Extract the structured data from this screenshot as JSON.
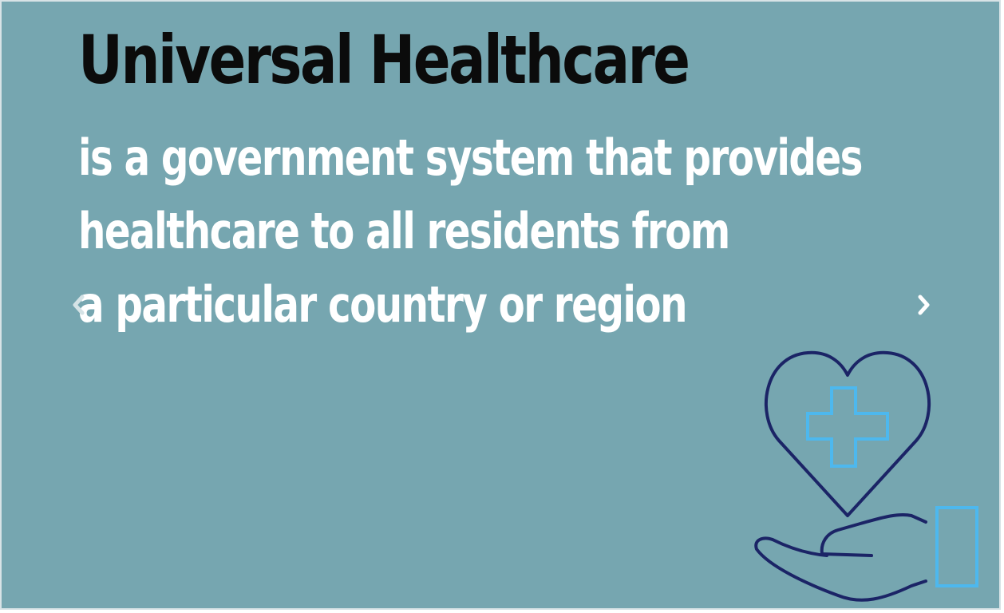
{
  "slide": {
    "title": "Universal Healthcare",
    "subtitle_lines": [
      "is a government system that provides",
      "healthcare to all residents from",
      "a particular country or region"
    ]
  },
  "navigation": {
    "prev_icon": "chevron-left-icon",
    "next_icon": "chevron-right-icon"
  },
  "illustration": {
    "icon": "heart-medical-cross-hand-icon"
  },
  "colors": {
    "background": "#76a6b0",
    "title": "#0b0b0b",
    "subtitle": "#ffffff",
    "icon_dark": "#1b2466",
    "icon_light": "#4db8ee"
  }
}
